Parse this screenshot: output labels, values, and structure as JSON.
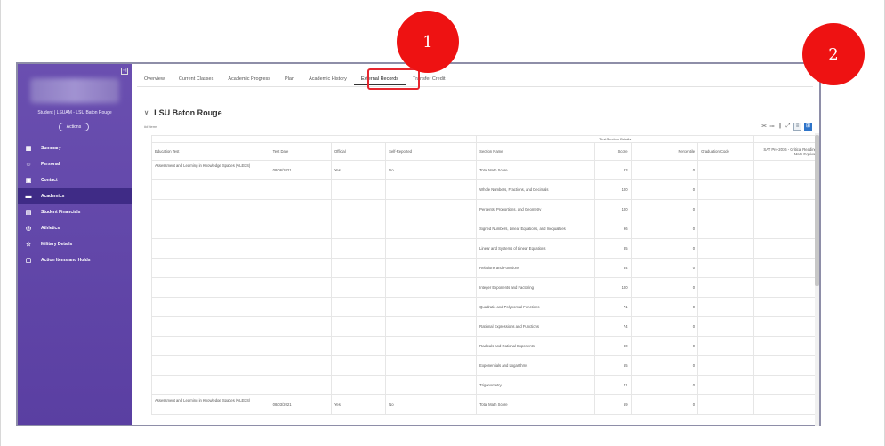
{
  "sidebar": {
    "student": "Student | LSUAM - LSU Baton Rouge",
    "actions": "Actions",
    "collapse_glyph": "⊣",
    "items": [
      {
        "label": "Summary",
        "icon": "▦"
      },
      {
        "label": "Personal",
        "icon": "☺"
      },
      {
        "label": "Contact",
        "icon": "▣"
      },
      {
        "label": "Academics",
        "icon": "▬"
      },
      {
        "label": "Student Financials",
        "icon": "▤"
      },
      {
        "label": "Athletics",
        "icon": "◎"
      },
      {
        "label": "Military Details",
        "icon": "☆"
      },
      {
        "label": "Action Items and Holds",
        "icon": "▢"
      }
    ]
  },
  "tabs": [
    "Overview",
    "Current Classes",
    "Academic Progress",
    "Plan",
    "Academic History",
    "External Records",
    "Transfer Credit"
  ],
  "active_tab": "External Records",
  "section": {
    "title": "LSU Baton Rouge",
    "items_count": "## items"
  },
  "table": {
    "group_header": "Test Section Details",
    "headers": {
      "education_test": "Education Test",
      "test_date": "Test Date",
      "official": "Official",
      "self_reported": "Self-Reported",
      "section_name": "Section Name",
      "score": "Score",
      "percentile": "Percentile",
      "graduation_code": "Graduation Code",
      "sat_equivalency": "SAT Pre-2016 - Critical Reading and Math Equivalency"
    },
    "rows": [
      {
        "education_test": "Assessment and Learning in Knowledge Spaces (ALEKS)",
        "test_date": "08/06/2021",
        "official": "Yes",
        "self_reported": "No",
        "section_name": "Total Math Score",
        "score": "83",
        "percentile": "0",
        "graduation_code": "",
        "sat": "0"
      },
      {
        "education_test": "",
        "test_date": "",
        "official": "",
        "self_reported": "",
        "section_name": "Whole Numbers, Fractions, and Decimals",
        "score": "100",
        "percentile": "0",
        "graduation_code": "",
        "sat": ""
      },
      {
        "education_test": "",
        "test_date": "",
        "official": "",
        "self_reported": "",
        "section_name": "Percents, Proportions, and Geometry",
        "score": "100",
        "percentile": "0",
        "graduation_code": "",
        "sat": ""
      },
      {
        "education_test": "",
        "test_date": "",
        "official": "",
        "self_reported": "",
        "section_name": "Signed Numbers, Linear Equations, and Inequalities",
        "score": "96",
        "percentile": "0",
        "graduation_code": "",
        "sat": ""
      },
      {
        "education_test": "",
        "test_date": "",
        "official": "",
        "self_reported": "",
        "section_name": "Linear and Systems of Linear Equations",
        "score": "85",
        "percentile": "0",
        "graduation_code": "",
        "sat": ""
      },
      {
        "education_test": "",
        "test_date": "",
        "official": "",
        "self_reported": "",
        "section_name": "Relations and Functions",
        "score": "84",
        "percentile": "0",
        "graduation_code": "",
        "sat": ""
      },
      {
        "education_test": "",
        "test_date": "",
        "official": "",
        "self_reported": "",
        "section_name": "Integer Exponents and Factoring",
        "score": "100",
        "percentile": "0",
        "graduation_code": "",
        "sat": ""
      },
      {
        "education_test": "",
        "test_date": "",
        "official": "",
        "self_reported": "",
        "section_name": "Quadratic and Polynomial Functions",
        "score": "71",
        "percentile": "0",
        "graduation_code": "",
        "sat": ""
      },
      {
        "education_test": "",
        "test_date": "",
        "official": "",
        "self_reported": "",
        "section_name": "Rational Expressions and Functions",
        "score": "74",
        "percentile": "0",
        "graduation_code": "",
        "sat": ""
      },
      {
        "education_test": "",
        "test_date": "",
        "official": "",
        "self_reported": "",
        "section_name": "Radicals and Rational Exponents",
        "score": "80",
        "percentile": "0",
        "graduation_code": "",
        "sat": ""
      },
      {
        "education_test": "",
        "test_date": "",
        "official": "",
        "self_reported": "",
        "section_name": "Exponentials and Logarithms",
        "score": "65",
        "percentile": "0",
        "graduation_code": "",
        "sat": ""
      },
      {
        "education_test": "",
        "test_date": "",
        "official": "",
        "self_reported": "",
        "section_name": "Trigonometry",
        "score": "41",
        "percentile": "0",
        "graduation_code": "",
        "sat": ""
      },
      {
        "education_test": "Assessment and Learning in Knowledge Spaces (ALEKS)",
        "test_date": "08/03/2021",
        "official": "Yes",
        "self_reported": "No",
        "section_name": "Total Math Score",
        "score": "69",
        "percentile": "0",
        "graduation_code": "",
        "sat": "0"
      }
    ]
  },
  "toolbar": [
    "⫘",
    "⩴",
    "❙",
    "⤢"
  ],
  "annotations": {
    "marker_1": "1",
    "marker_2": "2"
  },
  "colors": {
    "sidebar": "#5a3fa2",
    "active_item": "#3f2b86",
    "highlight": "#e6262e",
    "marker": "#ee1212"
  }
}
